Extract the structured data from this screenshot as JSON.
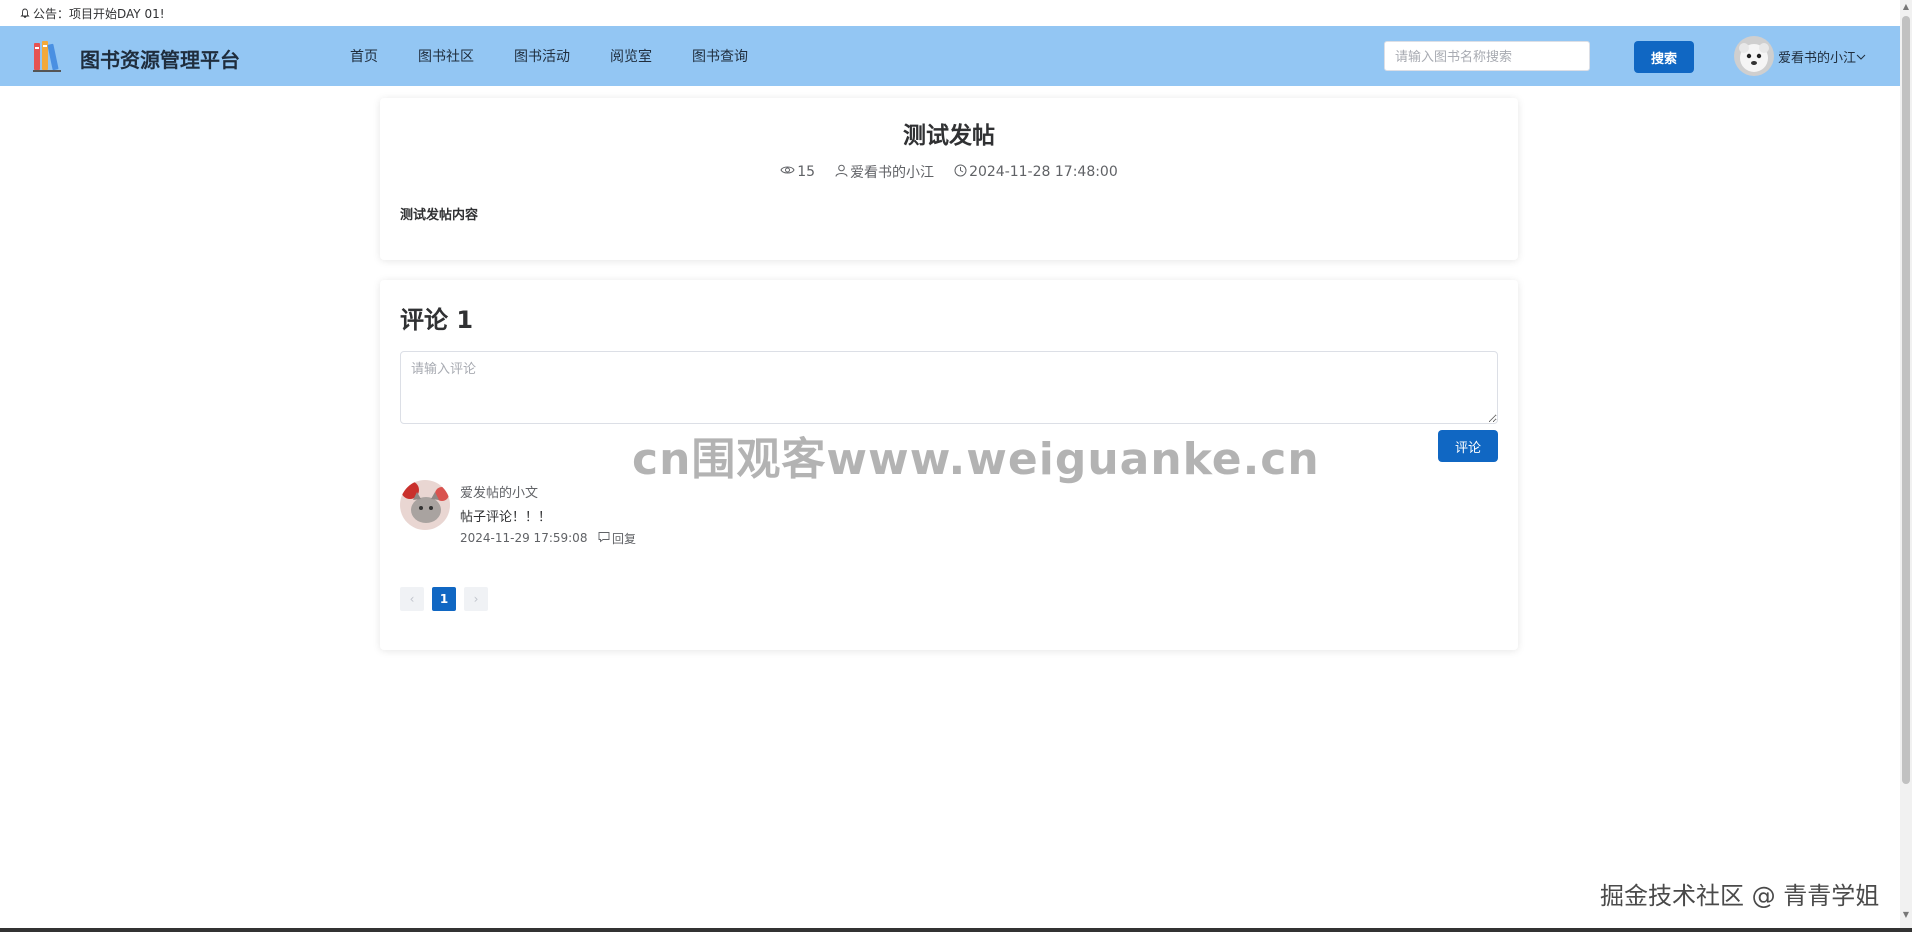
{
  "notice": {
    "text": "公告：项目开始DAY 01!"
  },
  "header": {
    "app_title": "图书资源管理平台",
    "menu": [
      {
        "label": "首页"
      },
      {
        "label": "图书社区"
      },
      {
        "label": "图书活动"
      },
      {
        "label": "阅览室"
      },
      {
        "label": "图书查询"
      }
    ],
    "search": {
      "placeholder": "请输入图书名称搜索",
      "value": "",
      "button": "搜索"
    },
    "user": {
      "name": "爱看书的小江"
    },
    "colors": {
      "navbar": "#93c6f3",
      "primary": "#1067c3"
    }
  },
  "post": {
    "title": "测试发帖",
    "views": "15",
    "author": "爱看书的小江",
    "time": "2024-11-28 17:48:00",
    "content": "测试发帖内容"
  },
  "comments_section": {
    "title": "评论 1",
    "input_placeholder": "请输入评论",
    "input_value": "",
    "submit_label": "评论",
    "items": [
      {
        "user": "爱发帖的小文",
        "text": "帖子评论！！！",
        "time": "2024-11-29 17:59:08",
        "reply_label": "回复"
      }
    ],
    "pagination": {
      "prev": "‹",
      "current": "1",
      "next": "›"
    }
  },
  "watermark": "cn围观客www.weiguanke.cn",
  "credit": "掘金技术社区 @ 青青学姐"
}
